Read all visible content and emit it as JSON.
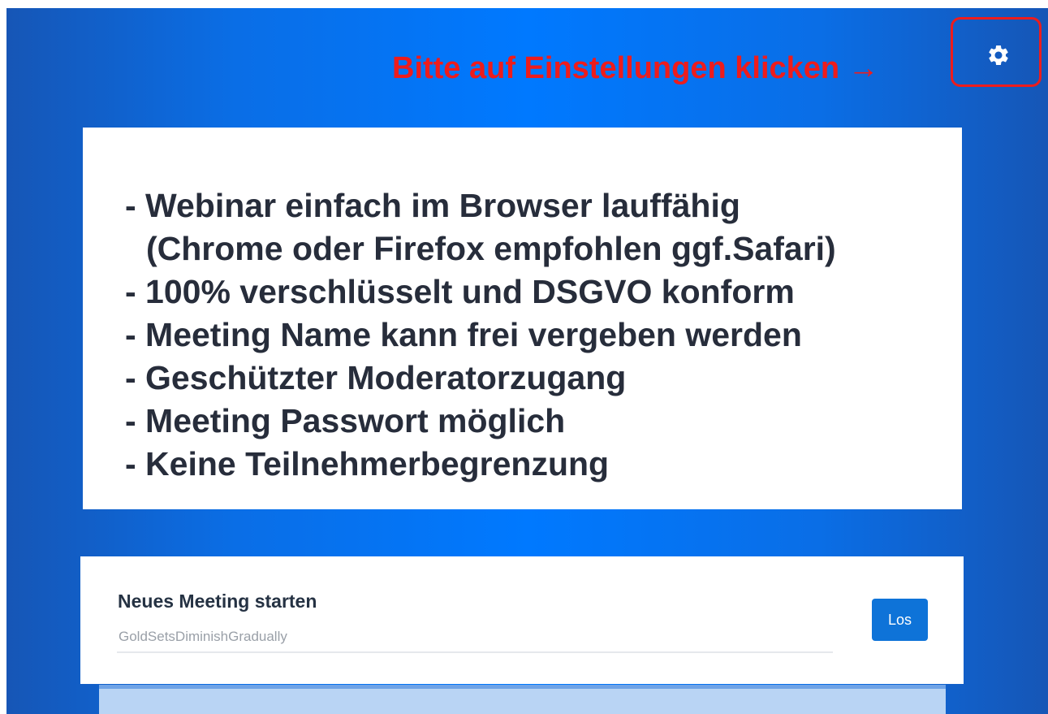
{
  "hint": {
    "text": "Bitte auf Einstellungen klicken →",
    "color": "#ee1c1c"
  },
  "settings": {
    "icon": "gear-icon"
  },
  "features": [
    "- Webinar einfach im Browser lauffähig",
    "(Chrome oder Firefox empfohlen ggf.Safari)",
    "- 100% verschlüsselt und DSGVO konform",
    "- Meeting Name kann frei vergeben werden",
    "- Geschützter Moderatorzugang",
    "- Meeting Passwort möglich",
    "- Keine Teilnehmerbegrenzung"
  ],
  "meeting": {
    "title": "Neues Meeting starten",
    "placeholder": "GoldSetsDiminishGradually",
    "button_label": "Los"
  },
  "colors": {
    "background_center": "#0079ff",
    "background_edge": "#1656b6",
    "button": "#0e73d8",
    "text_dark": "#272d3b"
  }
}
